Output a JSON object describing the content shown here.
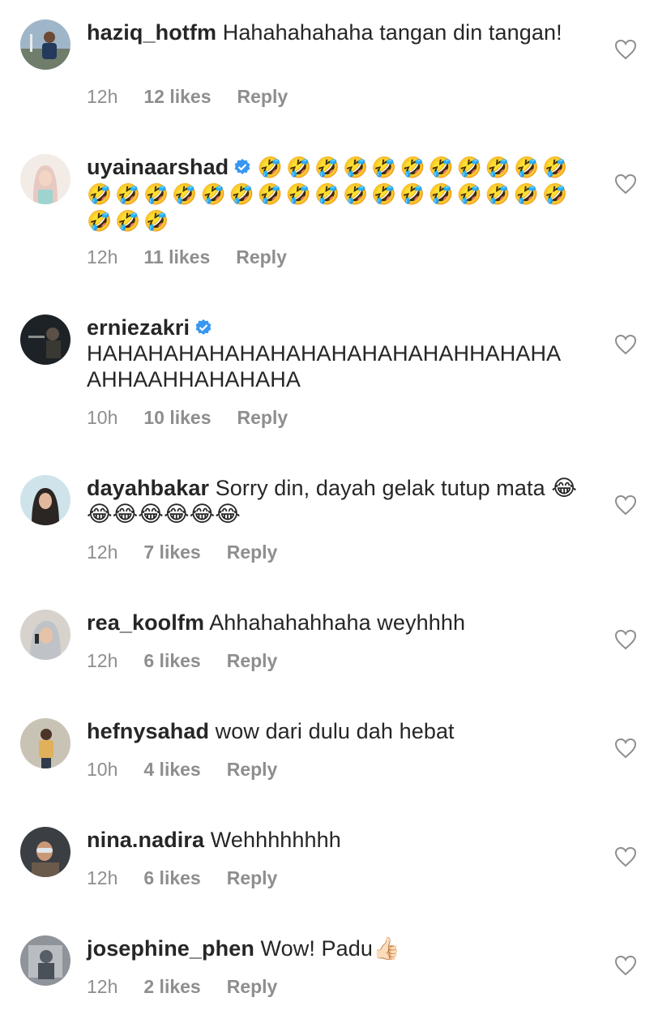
{
  "comments": [
    {
      "username": "haziq_hotfm",
      "verified": false,
      "text": "Hahahahahaha tangan din tangan!",
      "time": "12h",
      "likes": "12 likes",
      "reply": "Reply"
    },
    {
      "username": "uyainaarshad",
      "verified": true,
      "text": "🤣🤣🤣🤣🤣🤣🤣🤣🤣🤣🤣🤣🤣🤣🤣🤣🤣🤣🤣🤣🤣🤣🤣🤣🤣🤣🤣🤣🤣🤣🤣",
      "time": "12h",
      "likes": "11 likes",
      "reply": "Reply"
    },
    {
      "username": "erniezakri",
      "verified": true,
      "text": "HAHAHAHAHAHAHAHAHAHAHAHAHHAHAHA AHHAAHHAHAHAHA",
      "time": "10h",
      "likes": "10 likes",
      "reply": "Reply"
    },
    {
      "username": "dayahbakar",
      "verified": false,
      "text": "Sorry din, dayah gelak tutup mata 😂😂😂😂😂😂😂",
      "time": "12h",
      "likes": "7 likes",
      "reply": "Reply"
    },
    {
      "username": "rea_koolfm",
      "verified": false,
      "text": "Ahhahahahhaha weyhhhh",
      "time": "12h",
      "likes": "6 likes",
      "reply": "Reply"
    },
    {
      "username": "hefnysahad",
      "verified": false,
      "text": "wow dari dulu dah hebat",
      "time": "10h",
      "likes": "4 likes",
      "reply": "Reply"
    },
    {
      "username": "nina.nadira",
      "verified": false,
      "text": "Wehhhhhhhh",
      "time": "12h",
      "likes": "6 likes",
      "reply": "Reply"
    },
    {
      "username": "josephine_phen",
      "verified": false,
      "text": "Wow! Padu👍🏻",
      "time": "12h",
      "likes": "2 likes",
      "reply": "Reply"
    }
  ],
  "colors": {
    "text": "#262626",
    "meta": "#8e8e8e",
    "verified": "#3897f0",
    "heart": "#8e8e8e"
  },
  "icons": {
    "heart": "heart-outline-icon",
    "verified": "verified-badge-icon"
  }
}
